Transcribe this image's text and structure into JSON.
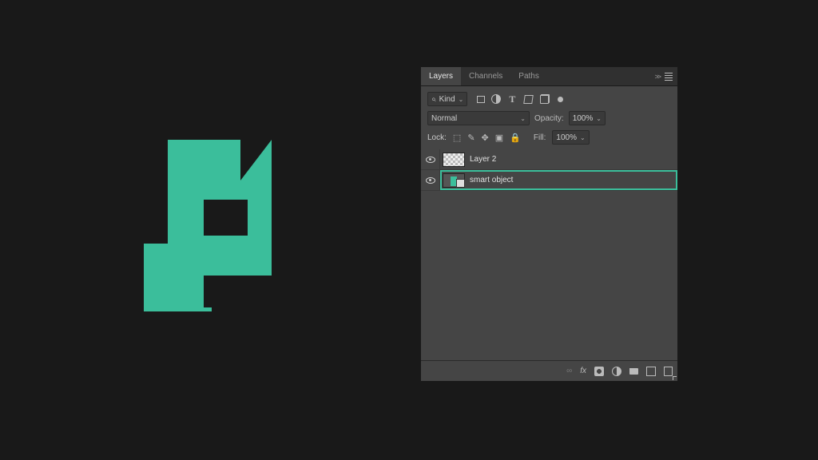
{
  "artwork": {
    "color": "#3bbe9b"
  },
  "panel": {
    "tabs": {
      "layers": "Layers",
      "channels": "Channels",
      "paths": "Paths"
    },
    "filter": {
      "label": "Kind"
    },
    "blend": {
      "mode": "Normal",
      "opacity_label": "Opacity:",
      "opacity_value": "100%"
    },
    "lock": {
      "label": "Lock:",
      "fill_label": "Fill:",
      "fill_value": "100%"
    },
    "layers": [
      {
        "name": "Layer 2",
        "selected": false,
        "type": "raster"
      },
      {
        "name": "smart object",
        "selected": true,
        "type": "smart_object"
      }
    ],
    "footer_fx": "fx"
  }
}
